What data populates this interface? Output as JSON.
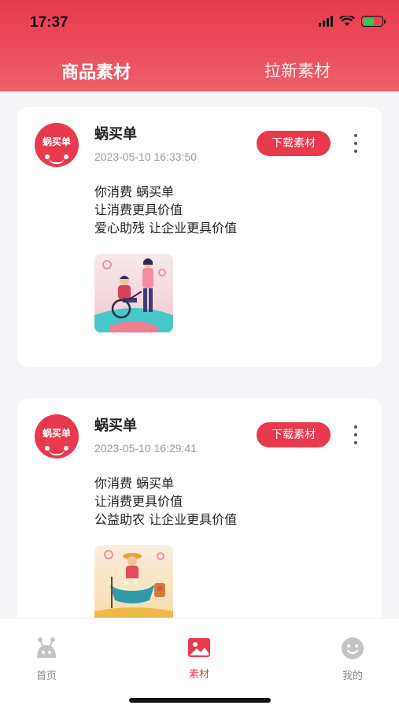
{
  "status_bar": {
    "time": "17:37"
  },
  "header": {
    "tabs": [
      {
        "label": "商品素材",
        "active": true
      },
      {
        "label": "拉新素材",
        "active": false
      }
    ]
  },
  "feed": [
    {
      "author": "蜗买单",
      "avatar_text": "蜗买单",
      "date": "2023-05-10 16:33:50",
      "download_label": "下载素材",
      "lines": [
        "你消费 蜗买单",
        "让消费更具价值",
        "爱心助残 让企业更具价值"
      ],
      "image": "wheelchair-charity-illustration"
    },
    {
      "author": "蜗买单",
      "avatar_text": "蜗买单",
      "date": "2023-05-10 16:29:41",
      "download_label": "下载素材",
      "lines": [
        "你消费 蜗买单",
        "让消费更具价值",
        "公益助农 让企业更具价值"
      ],
      "image": "farmer-harvest-illustration"
    }
  ],
  "tabbar": {
    "items": [
      {
        "label": "首页",
        "icon": "snail-icon",
        "active": false
      },
      {
        "label": "素材",
        "icon": "image-icon",
        "active": true
      },
      {
        "label": "我的",
        "icon": "smiley-icon",
        "active": false
      }
    ]
  },
  "colors": {
    "accent": "#e8394d",
    "background": "#f5f5f7"
  }
}
